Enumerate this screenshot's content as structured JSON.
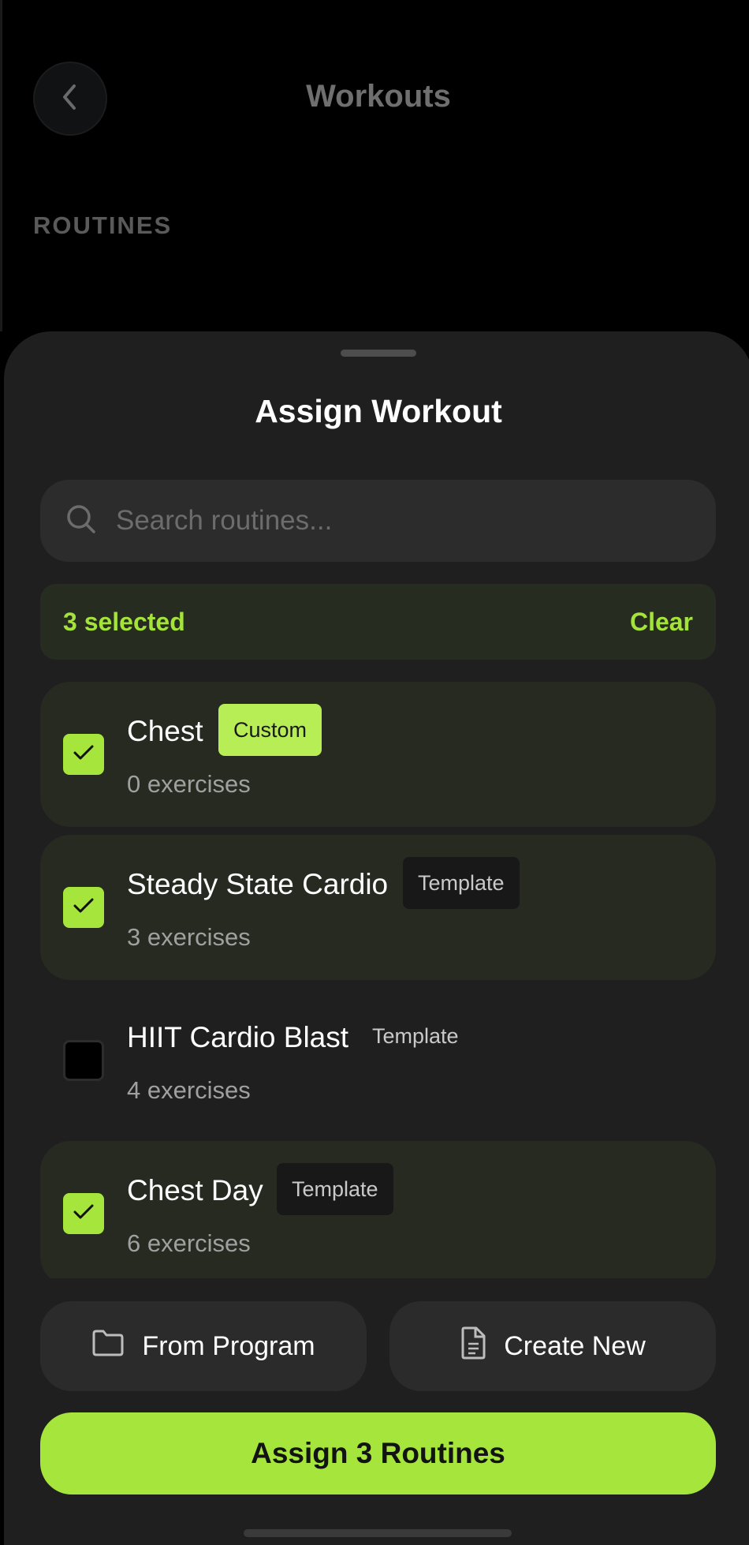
{
  "background": {
    "title": "Workouts",
    "section_label": "ROUTINES"
  },
  "sheet": {
    "title": "Assign Workout"
  },
  "search": {
    "placeholder": "Search routines..."
  },
  "selection": {
    "count_text": "3 selected",
    "clear_label": "Clear"
  },
  "routines": [
    {
      "name": "Chest",
      "badge": "Custom",
      "exercises": "0 exercises",
      "selected": true
    },
    {
      "name": "Steady State Cardio",
      "badge": "Template",
      "exercises": "3 exercises",
      "selected": true
    },
    {
      "name": "HIIT Cardio Blast",
      "badge": "Template",
      "exercises": "4 exercises",
      "selected": false
    },
    {
      "name": "Chest Day",
      "badge": "Template",
      "exercises": "6 exercises",
      "selected": true
    }
  ],
  "actions": {
    "from_program_label": "From Program",
    "create_new_label": "Create New",
    "assign_label": "Assign 3 Routines"
  },
  "colors": {
    "accent": "#a6e53b",
    "sheet_bg": "#1f1f1f",
    "selected_row_bg": "#262a21"
  },
  "icons": {
    "back": "chevron-left-icon",
    "search": "search-icon",
    "checkbox": "checkmark-icon",
    "from_program": "folder-icon",
    "create_new": "document-icon"
  }
}
